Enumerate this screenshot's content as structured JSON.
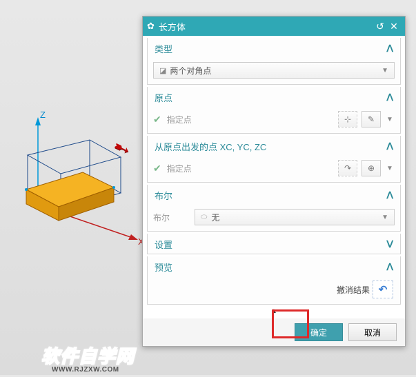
{
  "titlebar": {
    "title": "长方体"
  },
  "sections": {
    "type": {
      "title": "类型",
      "dropdown_value": "两个对角点"
    },
    "origin": {
      "title": "原点",
      "spec_point": "指定点"
    },
    "from_origin": {
      "title": "从原点出发的点 XC, YC, ZC",
      "spec_point": "指定点"
    },
    "boolean": {
      "title": "布尔",
      "label": "布尔",
      "value": "无"
    },
    "settings": {
      "title": "设置"
    },
    "preview": {
      "title": "预览",
      "undo_label": "撤消结果"
    }
  },
  "buttons": {
    "ok": "确定",
    "cancel": "取消"
  },
  "axes": {
    "z": "Z",
    "x": "X"
  },
  "watermark": {
    "text": "软件自学网",
    "url": "WWW.RJZXW.COM"
  }
}
